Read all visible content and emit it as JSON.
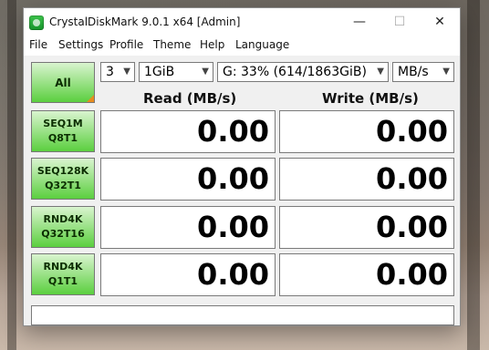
{
  "window": {
    "title": "CrystalDiskMark 9.0.1 x64 [Admin]",
    "controls": {
      "minimize": "—",
      "maximize": "☐",
      "close": "✕"
    }
  },
  "menu": [
    "File",
    "Settings",
    "Profile",
    "Theme",
    "Help",
    "Language"
  ],
  "toolbar": {
    "all_label": "All",
    "count": "3",
    "size": "1GiB",
    "drive": "G: 33% (614/1863GiB)",
    "unit": "MB/s",
    "dropdown_icon": "chevron-down-icon"
  },
  "headers": {
    "read": "Read (MB/s)",
    "write": "Write (MB/s)"
  },
  "tests": [
    {
      "name": "SEQ1M",
      "params": "Q8T1",
      "read": "0.00",
      "write": "0.00"
    },
    {
      "name": "SEQ128K",
      "params": "Q32T1",
      "read": "0.00",
      "write": "0.00"
    },
    {
      "name": "RND4K",
      "params": "Q32T16",
      "read": "0.00",
      "write": "0.00"
    },
    {
      "name": "RND4K",
      "params": "Q1T1",
      "read": "0.00",
      "write": "0.00"
    }
  ],
  "status": "",
  "colors": {
    "button_green_top": "#d9f4cf",
    "button_green_bottom": "#5bcf3f",
    "corner_accent": "#e88c1e"
  }
}
